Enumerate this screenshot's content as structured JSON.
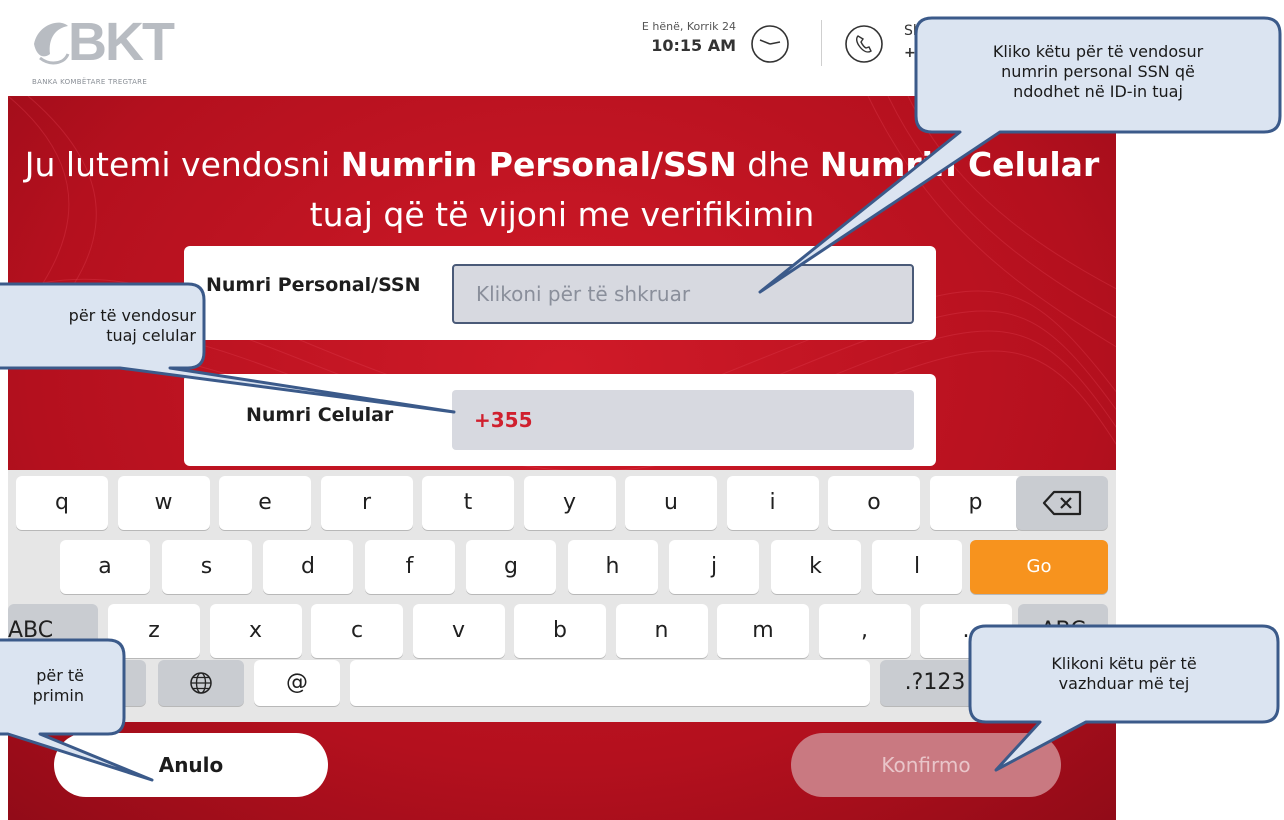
{
  "header": {
    "logo_text": "BKT",
    "logo_subtitle": "BANKA KOMBËTARE TREGTARE",
    "date": "E hënë, Korrik 24",
    "time": "10:15 AM",
    "support_line1": "Sh",
    "support_line2": "+"
  },
  "title": {
    "part1": "Ju lutemi vendosni ",
    "bold1": "Numrin Personal/SSN",
    "part2": " dhe ",
    "bold2": "Numrin Celular",
    "line2": "tuaj që të vijoni me verifikimin"
  },
  "form": {
    "ssn_label": "Numri Personal/SSN",
    "ssn_placeholder": "Klikoni për të shkruar",
    "phone_label": "Numri Celular",
    "phone_value": "+355"
  },
  "keyboard": {
    "row1": [
      "q",
      "w",
      "e",
      "r",
      "t",
      "y",
      "u",
      "i",
      "o",
      "p"
    ],
    "row2": [
      "a",
      "s",
      "d",
      "f",
      "g",
      "h",
      "j",
      "k",
      "l"
    ],
    "row3": [
      "z",
      "x",
      "c",
      "v",
      "b",
      "n",
      "m",
      ",",
      "."
    ],
    "go_label": "Go",
    "abc_left": "ABC",
    "abc_right": "ABC",
    "at_key": "@",
    "numbers_key": ".?123"
  },
  "buttons": {
    "cancel": "Anulo",
    "confirm": "Konfirmo"
  },
  "callouts": {
    "ssn": [
      "Kliko këtu për të vendosur",
      "numrin personal SSN që",
      "ndodhet në ID-in tuaj"
    ],
    "phone": [
      "për të vendosur",
      "tuaj celular"
    ],
    "cancel": [
      "për të",
      "primin"
    ],
    "confirm": [
      "Klikoni këtu për të",
      "vazhduar më tej"
    ]
  },
  "colors": {
    "brand_red": "#b4101e",
    "go_orange": "#f7931e",
    "callout_fill": "#dbe4f1",
    "callout_border": "#3b5a8a"
  }
}
